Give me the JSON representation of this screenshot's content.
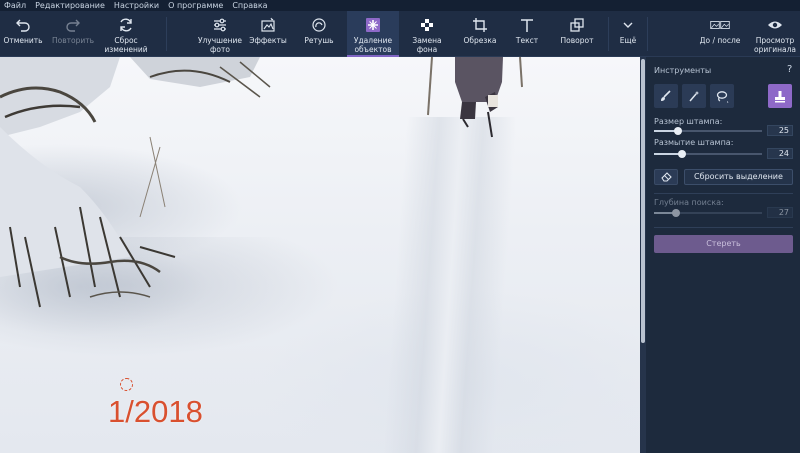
{
  "menu": [
    "Файл",
    "Редактирование",
    "Настройки",
    "О программе",
    "Справка"
  ],
  "toolbar": {
    "undo": "Отменить",
    "redo": "Повторить",
    "reset": "Сброс\nизменений",
    "enhance": "Улучшение\nфото",
    "effects": "Эффекты",
    "retouch": "Ретушь",
    "object_removal": "Удаление\nобъектов",
    "bg_replace": "Замена\nфона",
    "crop": "Обрезка",
    "text": "Текст",
    "rotate": "Поворот",
    "more": "Ещё",
    "before_after": "До / после",
    "preview": "Просмотр\nоригинала"
  },
  "photo": {
    "watermark": "1/2018"
  },
  "panel": {
    "title": "Инструменты",
    "help": "?",
    "stamp_size_label": "Размер штампа:",
    "stamp_size_value": "25",
    "stamp_size_fraction": 0.22,
    "stamp_blur_label": "Размытие штампа:",
    "stamp_blur_value": "24",
    "stamp_blur_fraction": 0.26,
    "reset_selection": "Сбросить выделение",
    "search_depth_label": "Глубина поиска:",
    "search_depth_value": "27",
    "search_depth_fraction": 0.2,
    "erase": "Стереть"
  },
  "colors": {
    "accent": "#8e69c8",
    "toolbar_bg": "#1f2d44",
    "panel_bg": "#1d2a3d",
    "watermark": "#d9502f"
  }
}
